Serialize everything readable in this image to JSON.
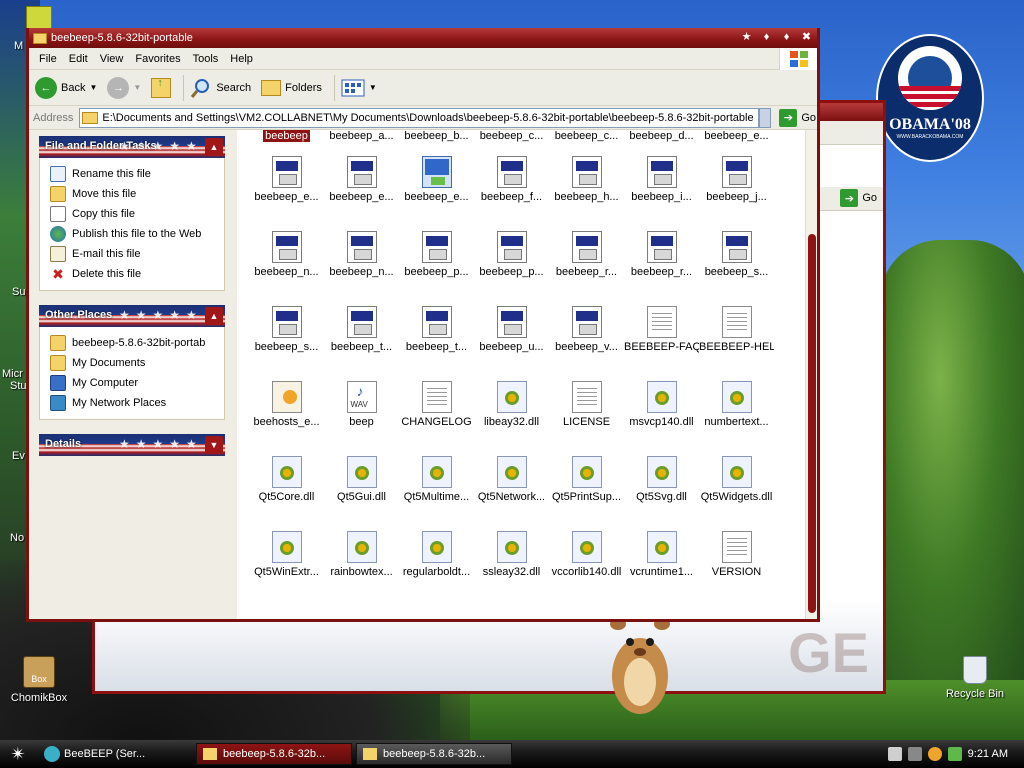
{
  "desktop": {
    "obama": {
      "name": "OBAMA'08",
      "site": "WWW.BARACKOBAMA.COM"
    },
    "side_labels": [
      "M",
      "Su",
      "Micr",
      "Stu",
      "Ev",
      "No"
    ],
    "chomikbox": {
      "label": "ChomikBox",
      "overlay": "Box"
    },
    "recycle": {
      "label": "Recycle Bin"
    },
    "back_text": "GE"
  },
  "window": {
    "title": "beebeep-5.8.6-32bit-portable",
    "menu": [
      "File",
      "Edit",
      "View",
      "Favorites",
      "Tools",
      "Help"
    ],
    "toolbar": {
      "back": "Back",
      "search": "Search",
      "folders": "Folders"
    },
    "address": {
      "label": "Address",
      "value": "E:\\Documents and Settings\\VM2.COLLABNET\\My Documents\\Downloads\\beebeep-5.8.6-32bit-portable\\beebeep-5.8.6-32bit-portable",
      "go": "Go"
    }
  },
  "taskpane": {
    "file_tasks": {
      "title": "File and Folder Tasks",
      "items": [
        {
          "label": "Rename this file",
          "icon": "rename-icon"
        },
        {
          "label": "Move this file",
          "icon": "move-icon"
        },
        {
          "label": "Copy this file",
          "icon": "copy-icon"
        },
        {
          "label": "Publish this file to the Web",
          "icon": "globe-icon"
        },
        {
          "label": "E-mail this file",
          "icon": "email-icon"
        },
        {
          "label": "Delete this file",
          "icon": "delete-icon"
        }
      ]
    },
    "other_places": {
      "title": "Other Places",
      "items": [
        {
          "label": "beebeep-5.8.6-32bit-portab",
          "icon": "folder-icon"
        },
        {
          "label": "My Documents",
          "icon": "my-documents-icon"
        },
        {
          "label": "My Computer",
          "icon": "my-computer-icon"
        },
        {
          "label": "My Network Places",
          "icon": "network-places-icon"
        }
      ]
    },
    "details": {
      "title": "Details"
    }
  },
  "files": [
    {
      "name": "beebeep",
      "type": "exe",
      "selected": true
    },
    {
      "name": "beebeep_a...",
      "type": "doc"
    },
    {
      "name": "beebeep_b...",
      "type": "doc"
    },
    {
      "name": "beebeep_c...",
      "type": "doc"
    },
    {
      "name": "beebeep_c...",
      "type": "doc"
    },
    {
      "name": "beebeep_d...",
      "type": "doc"
    },
    {
      "name": "beebeep_e...",
      "type": "doc"
    },
    {
      "name": "beebeep_e...",
      "type": "doc"
    },
    {
      "name": "beebeep_e...",
      "type": "doc"
    },
    {
      "name": "beebeep_e...",
      "type": "exe"
    },
    {
      "name": "beebeep_f...",
      "type": "doc"
    },
    {
      "name": "beebeep_h...",
      "type": "doc"
    },
    {
      "name": "beebeep_i...",
      "type": "doc"
    },
    {
      "name": "beebeep_j...",
      "type": "doc"
    },
    {
      "name": "beebeep_n...",
      "type": "doc"
    },
    {
      "name": "beebeep_n...",
      "type": "doc"
    },
    {
      "name": "beebeep_p...",
      "type": "doc"
    },
    {
      "name": "beebeep_p...",
      "type": "doc"
    },
    {
      "name": "beebeep_r...",
      "type": "doc"
    },
    {
      "name": "beebeep_r...",
      "type": "doc"
    },
    {
      "name": "beebeep_s...",
      "type": "doc"
    },
    {
      "name": "beebeep_s...",
      "type": "doc"
    },
    {
      "name": "beebeep_t...",
      "type": "doc"
    },
    {
      "name": "beebeep_t...",
      "type": "doc"
    },
    {
      "name": "beebeep_u...",
      "type": "doc"
    },
    {
      "name": "beebeep_v...",
      "type": "doc"
    },
    {
      "name": "BEEBEEP-FAQ",
      "type": "txt"
    },
    {
      "name": "BEEBEEP-HELP",
      "type": "txt"
    },
    {
      "name": "beehosts_e...",
      "type": "hosts"
    },
    {
      "name": "beep",
      "type": "wav"
    },
    {
      "name": "CHANGELOG",
      "type": "txt"
    },
    {
      "name": "libeay32.dll",
      "type": "dll"
    },
    {
      "name": "LICENSE",
      "type": "txt"
    },
    {
      "name": "msvcp140.dll",
      "type": "dll"
    },
    {
      "name": "numbertext...",
      "type": "dll"
    },
    {
      "name": "Qt5Core.dll",
      "type": "dll"
    },
    {
      "name": "Qt5Gui.dll",
      "type": "dll"
    },
    {
      "name": "Qt5Multime...",
      "type": "dll"
    },
    {
      "name": "Qt5Network...",
      "type": "dll"
    },
    {
      "name": "Qt5PrintSup...",
      "type": "dll"
    },
    {
      "name": "Qt5Svg.dll",
      "type": "dll"
    },
    {
      "name": "Qt5Widgets.dll",
      "type": "dll"
    },
    {
      "name": "Qt5WinExtr...",
      "type": "dll"
    },
    {
      "name": "rainbowtex...",
      "type": "dll"
    },
    {
      "name": "regularboldt...",
      "type": "dll"
    },
    {
      "name": "ssleay32.dll",
      "type": "dll"
    },
    {
      "name": "vccorlib140.dll",
      "type": "dll"
    },
    {
      "name": "vcruntime1...",
      "type": "dll"
    },
    {
      "name": "VERSION",
      "type": "txt"
    }
  ],
  "taskbar": {
    "quick_launch_text": "BeeBEEP (Ser...",
    "tasks": [
      {
        "label": "beebeep-5.8.6-32b...",
        "active": true
      },
      {
        "label": "beebeep-5.8.6-32b...",
        "active": false
      }
    ],
    "clock": "9:21 AM"
  },
  "colors": {
    "accent": "#8e1414",
    "titlebar": "#8a1414",
    "taskbar": "#000000"
  }
}
